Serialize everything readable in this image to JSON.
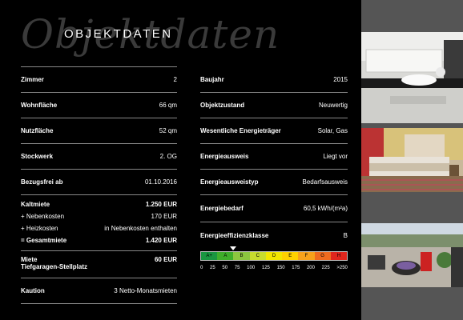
{
  "header": {
    "title": "OBJEKTDATEN",
    "script_text": "Objektdaten"
  },
  "left": {
    "rows": [
      {
        "label": "Zimmer",
        "value": "2"
      },
      {
        "label": "Wohnfläche",
        "value": "66 qm"
      },
      {
        "label": "Nutzfläche",
        "value": "52 qm"
      },
      {
        "label": "Stockwerk",
        "value": "2. OG"
      },
      {
        "label": "Bezugsfrei ab",
        "value": "01.10.2016"
      }
    ],
    "costs": [
      {
        "label": "Kaltmiete",
        "value": "1.250 EUR"
      },
      {
        "label": "+ Nebenkosten",
        "value": "170 EUR"
      },
      {
        "label": "+ Heizkosten",
        "value": "in Nebenkosten enthalten"
      },
      {
        "label": "= Gesamtmiete",
        "value": "1.420 EUR"
      }
    ],
    "parking": {
      "label_line1": "Miete",
      "label_line2": "Tiefgaragen-Stellplatz",
      "value": "60 EUR"
    },
    "deposit": {
      "label": "Kaution",
      "value": "3 Netto-Monatsmieten"
    }
  },
  "right": {
    "rows": [
      {
        "label": "Baujahr",
        "value": "2015"
      },
      {
        "label": "Objektzustand",
        "value": "Neuwertig"
      },
      {
        "label": "Wesentliche Energieträger",
        "value": "Solar, Gas"
      },
      {
        "label": "Energieausweis",
        "value": "Liegt vor"
      },
      {
        "label": "Energieausweistyp",
        "value": "Bedarfsausweis"
      },
      {
        "label": "Energiebedarf",
        "value": "60,5 kWh/(m²a)"
      },
      {
        "label": "Energieeffizienzklasse",
        "value": "B"
      }
    ]
  },
  "energy_scale": {
    "classes": [
      "A+",
      "A",
      "B",
      "C",
      "D",
      "E",
      "F",
      "G",
      "H"
    ],
    "colors": [
      "#1a9641",
      "#3fae2a",
      "#8cc63f",
      "#c8dc2e",
      "#f2e600",
      "#ffd100",
      "#f7a21b",
      "#ef6b1f",
      "#e0261d"
    ],
    "ticks": [
      "0",
      "25",
      "50",
      "75",
      "100",
      "125",
      "150",
      "175",
      "200",
      "225",
      ">250"
    ],
    "marker_value": 60.5,
    "marker_max": 275
  },
  "photos": [
    "bathroom-photo",
    "bedroom-photo",
    "terrace-photo"
  ]
}
